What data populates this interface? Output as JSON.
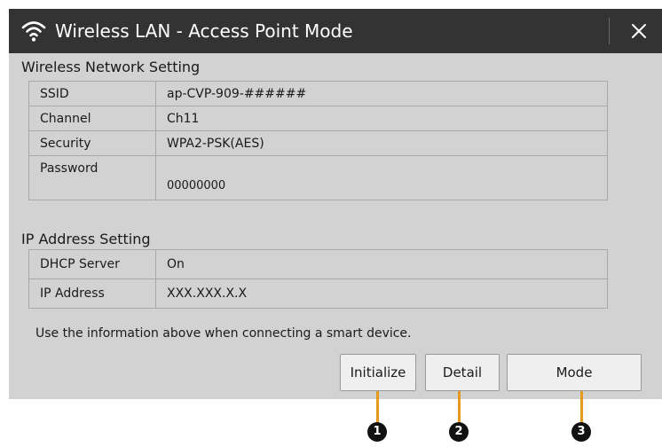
{
  "dialog": {
    "title": "Wireless LAN - Access Point Mode",
    "close_icon": "close-icon",
    "wifi_icon": "wifi-icon"
  },
  "wireless_section": {
    "heading": "Wireless Network Setting",
    "rows": [
      {
        "label": "SSID",
        "value": "ap-CVP-909-######"
      },
      {
        "label": "Channel",
        "value": "Ch11"
      },
      {
        "label": "Security",
        "value": "WPA2-PSK(AES)"
      },
      {
        "label": "Password",
        "value": "00000000"
      }
    ]
  },
  "ip_section": {
    "heading": "IP Address Setting",
    "rows": [
      {
        "label": "DHCP Server",
        "value": "On"
      },
      {
        "label": "IP Address",
        "value": "XXX.XXX.X.X"
      }
    ]
  },
  "footer": {
    "note": "Use the information above when connecting a smart device."
  },
  "buttons": {
    "initialize": "Initialize",
    "detail": "Detail",
    "mode": "Mode"
  },
  "callouts": [
    "1",
    "2",
    "3"
  ],
  "colors": {
    "titlebar": "#333333",
    "panel": "#d2d2d2",
    "callout_line": "#e39a1e",
    "callout_badge": "#111111"
  }
}
